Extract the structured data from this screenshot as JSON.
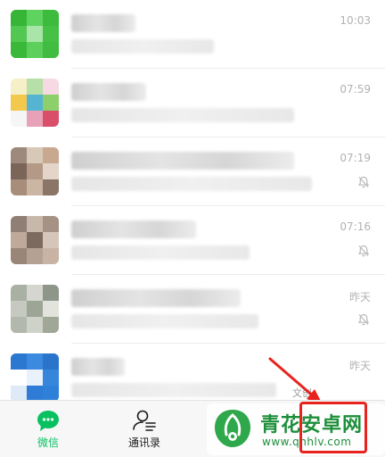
{
  "chats": [
    {
      "time": "10:03",
      "muted": false
    },
    {
      "time": "07:59",
      "muted": false
    },
    {
      "time": "07:19",
      "muted": true
    },
    {
      "time": "07:16",
      "muted": true
    },
    {
      "time": "昨天",
      "muted": true
    },
    {
      "time": "昨天",
      "muted": false
    }
  ],
  "snippet": "文创",
  "tabs": [
    {
      "label": "微信",
      "active": true
    },
    {
      "label": "通讯录",
      "active": false
    }
  ],
  "watermark": {
    "title": "青花安卓网",
    "url": "www.qhhlv.com"
  },
  "colors": {
    "accent": "#07c160",
    "highlight": "#e8231e",
    "watermark": "#1d8f3a"
  }
}
